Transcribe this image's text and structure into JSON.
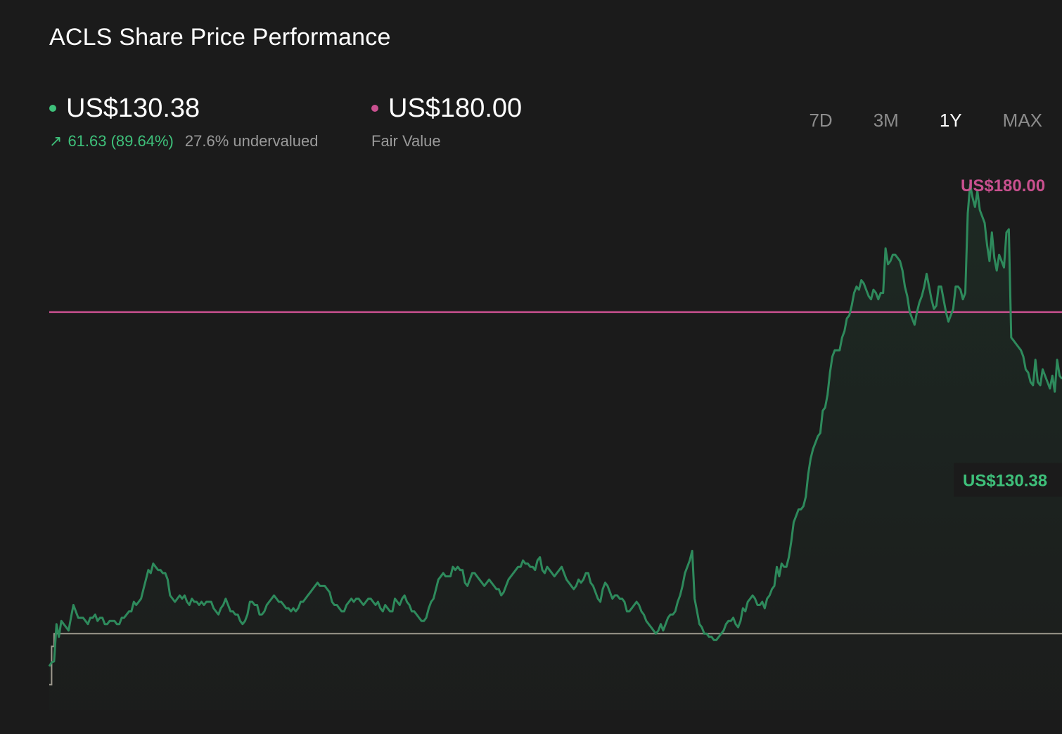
{
  "header": {
    "title": "ACLS Share Price Performance"
  },
  "current": {
    "price": "US$130.38",
    "change": "61.63 (89.64%)",
    "valuation": "27.6% undervalued",
    "color": "#3ec07a",
    "arrow_icon": "arrow-up-right-icon"
  },
  "fair_value": {
    "price": "US$180.00",
    "label": "Fair Value",
    "color": "#c9508f"
  },
  "tabs": [
    {
      "label": "7D",
      "active": false
    },
    {
      "label": "3M",
      "active": false
    },
    {
      "label": "1Y",
      "active": true
    },
    {
      "label": "MAX",
      "active": false
    }
  ],
  "chart_data": {
    "type": "line",
    "ylim": [
      55,
      225
    ],
    "series": [
      {
        "values": [
          68.75,
          70,
          70.3,
          82,
          78,
          83,
          82,
          81,
          80,
          84,
          88,
          86,
          84,
          84,
          84,
          83,
          82,
          84,
          84,
          85,
          83,
          84,
          84,
          82,
          82,
          83,
          83,
          83,
          82,
          82,
          84,
          84,
          85,
          86,
          86,
          89,
          88,
          89,
          90,
          93,
          96,
          99,
          98,
          101,
          100,
          99,
          99,
          98,
          98,
          96,
          91,
          90,
          89,
          90,
          91,
          90,
          91,
          89,
          88,
          90,
          89,
          89,
          88,
          89,
          88,
          89,
          89,
          89,
          87,
          86,
          85,
          87,
          88,
          90,
          88,
          86,
          86,
          85,
          85,
          83,
          82,
          83,
          85,
          89,
          89,
          88,
          88,
          85,
          85,
          86,
          88,
          89,
          90,
          91,
          90,
          89,
          89,
          88,
          87,
          87,
          86,
          87,
          86,
          87,
          89,
          89,
          90,
          91,
          92,
          93,
          94,
          95,
          94,
          94,
          94,
          93,
          92,
          89,
          88,
          88,
          87,
          86,
          86,
          88,
          89,
          90,
          89,
          90,
          90,
          89,
          88,
          89,
          90,
          90,
          89,
          88,
          89,
          87,
          86,
          88,
          87,
          86,
          86,
          90,
          89,
          88,
          90,
          91,
          89,
          88,
          86,
          86,
          85,
          84,
          83,
          83,
          84,
          87,
          89,
          90,
          93,
          96,
          97,
          98,
          97,
          97,
          97,
          100,
          99,
          100,
          99,
          99,
          95,
          94,
          96,
          98,
          98,
          97,
          96,
          95,
          94,
          95,
          96,
          95,
          94,
          93,
          93,
          91,
          92,
          94,
          96,
          97,
          98,
          99,
          100,
          100,
          102,
          101,
          101,
          100,
          100,
          99,
          102,
          103,
          99,
          98,
          100,
          99,
          98,
          97,
          98,
          99,
          100,
          98,
          96,
          95,
          94,
          93,
          94,
          96,
          95,
          96,
          98,
          98,
          95,
          94,
          92,
          90,
          89,
          93,
          95,
          94,
          92,
          90,
          91,
          91,
          90,
          90,
          89,
          86,
          86,
          87,
          88,
          89,
          88,
          86,
          85,
          83,
          82,
          81,
          80,
          79,
          80,
          82,
          80,
          82,
          84,
          85,
          85,
          86,
          89,
          91,
          94,
          98,
          100,
          102,
          105,
          90,
          86,
          82,
          81,
          79,
          79,
          78,
          78,
          77,
          77,
          78,
          79,
          80,
          82,
          83,
          83,
          84,
          82,
          81,
          83,
          87,
          86,
          89,
          90,
          91,
          90,
          88,
          88,
          89,
          87,
          90,
          91,
          93,
          94,
          100,
          97,
          101,
          100,
          100,
          103,
          108,
          114,
          116,
          118,
          118,
          119,
          122,
          129,
          134,
          137,
          139,
          141,
          142,
          149,
          150,
          154,
          161,
          166,
          168,
          168,
          168,
          172,
          174,
          178,
          179,
          182,
          186,
          188,
          187,
          190,
          189,
          187,
          185,
          184,
          187,
          186,
          184,
          186,
          186,
          200,
          195,
          196,
          198,
          198,
          197,
          196,
          193,
          188,
          185,
          180,
          178,
          176,
          180,
          183,
          185,
          188,
          192,
          188,
          184,
          181,
          182,
          188,
          188,
          184,
          180,
          177,
          179,
          181,
          188,
          188,
          187,
          184,
          186,
          211,
          220,
          216,
          213,
          218,
          212,
          210,
          208,
          201,
          196,
          205,
          197,
          193,
          198,
          196,
          194,
          205,
          206,
          172,
          171,
          170,
          169,
          168,
          166,
          162,
          161,
          158,
          157,
          165,
          158,
          157,
          162,
          160,
          158,
          156,
          160,
          155,
          165,
          160,
          159
        ]
      },
      {
        "values": [
          63,
          75,
          79,
          79,
          79,
          79,
          79,
          79,
          79,
          79,
          79,
          79,
          79,
          79,
          79,
          79,
          79,
          79,
          79,
          79,
          79,
          79,
          79,
          79,
          79,
          79,
          79,
          79,
          79,
          79,
          79,
          79,
          79,
          79,
          79,
          79,
          79,
          79,
          79,
          79,
          79,
          79,
          79,
          79,
          79,
          79,
          79,
          79,
          79,
          79,
          79,
          79,
          79,
          79,
          79,
          79,
          79,
          79,
          79,
          79,
          79,
          79,
          79,
          79,
          79,
          79,
          79,
          79,
          79,
          79,
          79,
          79,
          79,
          79,
          79,
          79,
          79,
          79,
          79,
          79,
          79,
          79,
          79,
          79,
          79,
          79,
          79,
          79,
          79,
          79,
          79,
          79,
          79,
          79,
          79,
          79,
          79,
          79,
          79,
          79,
          79,
          79,
          79,
          79,
          79,
          79,
          79,
          79,
          79,
          79,
          79,
          79,
          79,
          79,
          79,
          79,
          79,
          79,
          79,
          79,
          79,
          79,
          79,
          79,
          79,
          79,
          79,
          79,
          79,
          79,
          79,
          79,
          79,
          79,
          79,
          79,
          79,
          79,
          79,
          79,
          79,
          79,
          79,
          79,
          79,
          79,
          79,
          79,
          79,
          79,
          79,
          79,
          79,
          79,
          79,
          79,
          79,
          79,
          79,
          79,
          79,
          79,
          79,
          79,
          79,
          79,
          79,
          79,
          79,
          79,
          79,
          79,
          79,
          79,
          79,
          79,
          79,
          79,
          79,
          79,
          79,
          79,
          79,
          79,
          79,
          79,
          79,
          79,
          79,
          79,
          79,
          79,
          79,
          79,
          79,
          79,
          79,
          79,
          79,
          79,
          79,
          79,
          79,
          79,
          79,
          79,
          79,
          79,
          79,
          79,
          79,
          79,
          79,
          79,
          79,
          79,
          79,
          79,
          79,
          79,
          79,
          79,
          79,
          79,
          79,
          79,
          79,
          79,
          79,
          79,
          79,
          79,
          79,
          79,
          79,
          79,
          79,
          79,
          79,
          79,
          79,
          79,
          79,
          79,
          79,
          79,
          79,
          79,
          79,
          79,
          79,
          79,
          79,
          79,
          79,
          79,
          79,
          79,
          79,
          79,
          79,
          79,
          79,
          79,
          79,
          79,
          79,
          79,
          79,
          79,
          79,
          79,
          79,
          79,
          79,
          79,
          79,
          79,
          79,
          79,
          79,
          79,
          79,
          79,
          79,
          79,
          79,
          79,
          79,
          79,
          79,
          79,
          79,
          79,
          79,
          79,
          79,
          79,
          79,
          79,
          79,
          79,
          79,
          79,
          79,
          79,
          79,
          79,
          79,
          79,
          79,
          79,
          79,
          79,
          79,
          79,
          79,
          79,
          79,
          79,
          79,
          79,
          79,
          79,
          79,
          79,
          79,
          79,
          79,
          79,
          79,
          79,
          79,
          79,
          79,
          79,
          79,
          79,
          79,
          79,
          79,
          79,
          79,
          79,
          79,
          79,
          79,
          79,
          79,
          79,
          79,
          79,
          79,
          79,
          79,
          79,
          79,
          79,
          79,
          79,
          79,
          79,
          79,
          79,
          79,
          79,
          79,
          79,
          79,
          79,
          79,
          79,
          79,
          79,
          79,
          79,
          79,
          79,
          79,
          79,
          79,
          79,
          79,
          79,
          79,
          79,
          79,
          79,
          79,
          79,
          79,
          79,
          79,
          79,
          79,
          79,
          79,
          79,
          79,
          79,
          79,
          79,
          79,
          79,
          79,
          79,
          79,
          79,
          79,
          79,
          79,
          79,
          79,
          79,
          79,
          79,
          79,
          79,
          79,
          79,
          79,
          79,
          79,
          79,
          79,
          79,
          79,
          79,
          79
        ]
      }
    ],
    "fair_value_line": 180,
    "current_value": 130.38,
    "grid": false
  }
}
